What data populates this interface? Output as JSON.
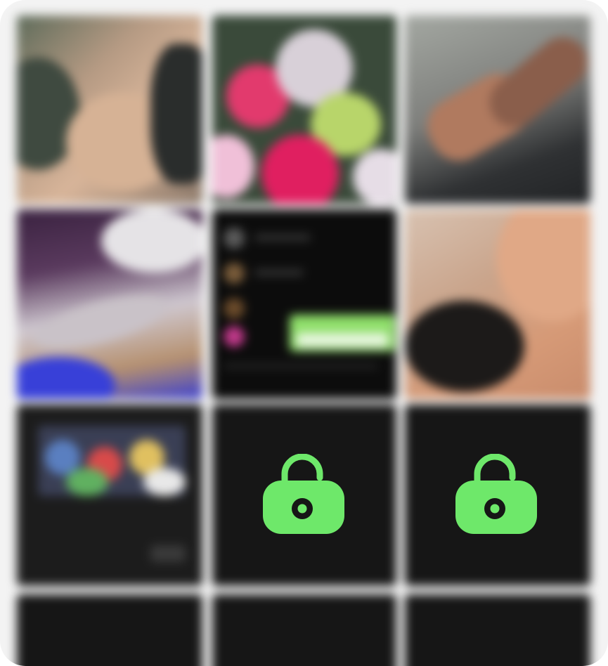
{
  "colors": {
    "card_background": "#f3f3f3",
    "locked_tile": "#161616",
    "lock_green": "#6ee86a"
  },
  "gallery": {
    "tiles": [
      {
        "kind": "photo",
        "state": "blurred",
        "subject": "beige"
      },
      {
        "kind": "photo",
        "state": "blurred",
        "subject": "flowers"
      },
      {
        "kind": "photo",
        "state": "blurred",
        "subject": "hand"
      },
      {
        "kind": "photo",
        "state": "blurred",
        "subject": "purple-room"
      },
      {
        "kind": "screenshot",
        "state": "blurred",
        "subject": "dark-app"
      },
      {
        "kind": "photo",
        "state": "blurred",
        "subject": "skin"
      },
      {
        "kind": "photo",
        "state": "blurred",
        "subject": "tv-screen"
      },
      {
        "kind": "locked",
        "icon": "unlock-icon"
      },
      {
        "kind": "locked",
        "icon": "unlock-icon"
      },
      {
        "kind": "locked",
        "icon": "none"
      },
      {
        "kind": "locked",
        "icon": "none"
      },
      {
        "kind": "locked",
        "icon": "none"
      }
    ]
  }
}
